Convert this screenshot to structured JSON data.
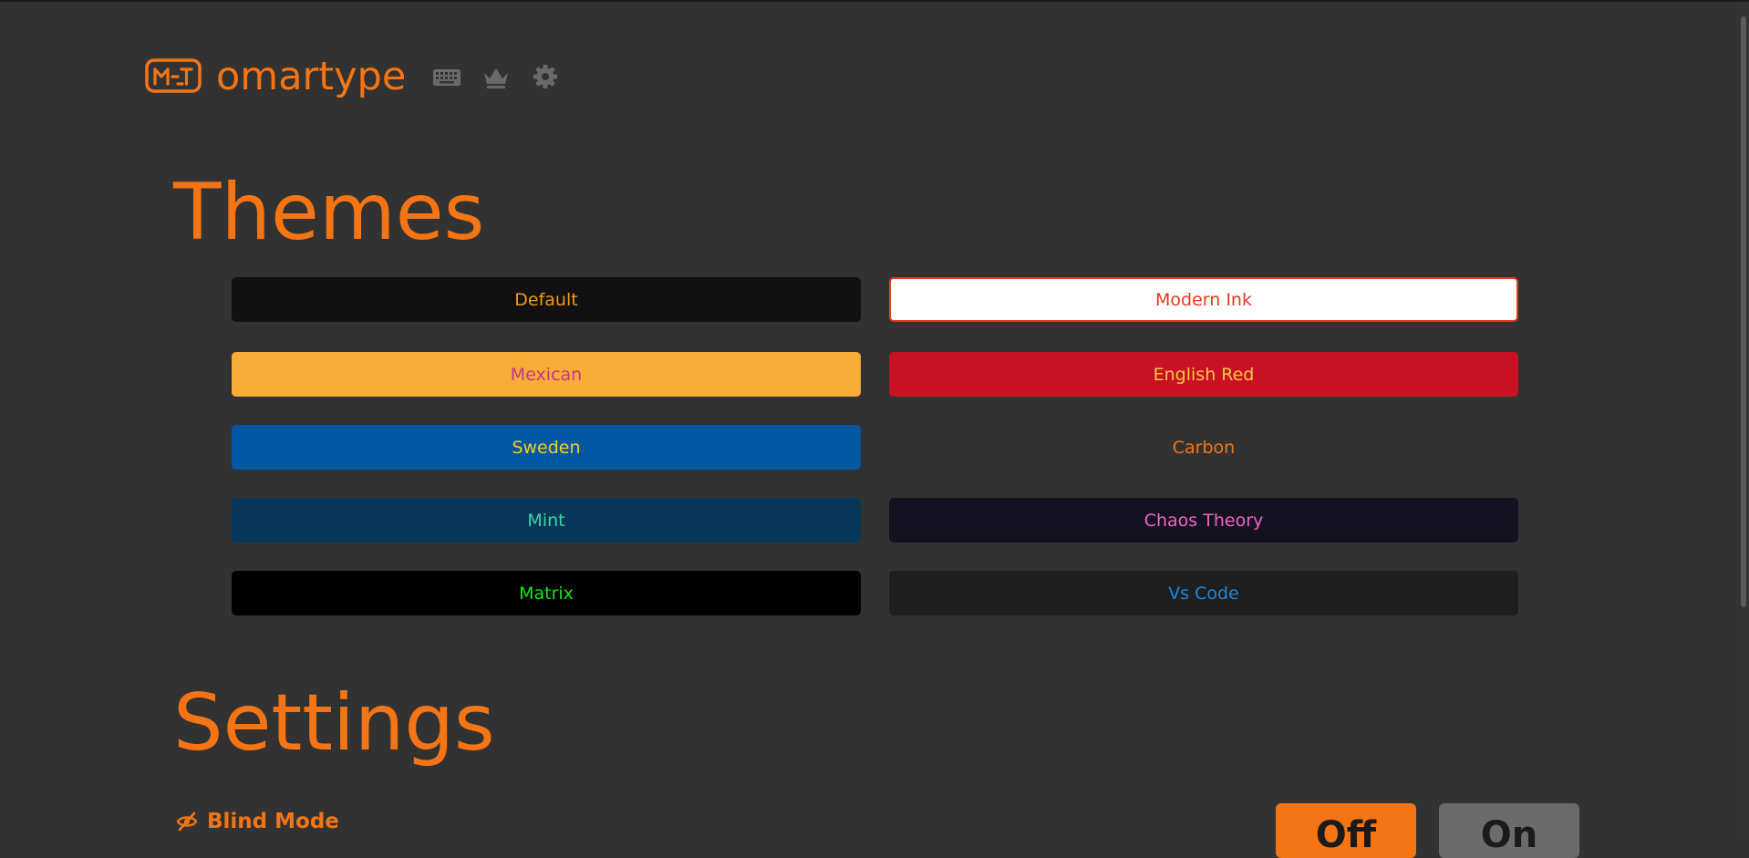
{
  "header": {
    "brand": "omartype",
    "logo_icon": "keyboard-logo-icon",
    "nav": [
      {
        "icon": "keyboard-icon"
      },
      {
        "icon": "crown-icon"
      },
      {
        "icon": "gear-icon"
      }
    ]
  },
  "themes": {
    "heading": "Themes",
    "items": [
      {
        "label": "Default",
        "bg": "#111111",
        "fg": "#f59a14"
      },
      {
        "label": "Modern Ink",
        "bg": "#ffffff",
        "fg": "#e8381f",
        "border": "#e8381f"
      },
      {
        "label": "Mexican",
        "bg": "#f7ad36",
        "fg": "#c2378a"
      },
      {
        "label": "English Red",
        "bg": "#c81224",
        "fg": "#f5c842"
      },
      {
        "label": "Sweden",
        "bg": "#0257a3",
        "fg": "#f5cf2a"
      },
      {
        "label": "Carbon",
        "bg": "#323232",
        "fg": "#f57514"
      },
      {
        "label": "Mint",
        "bg": "#06365a",
        "fg": "#3dd6a0"
      },
      {
        "label": "Chaos Theory",
        "bg": "#141221",
        "fg": "#f064c4"
      },
      {
        "label": "Matrix",
        "bg": "#000000",
        "fg": "#14e614"
      },
      {
        "label": "Vs Code",
        "bg": "#1f1f1f",
        "fg": "#1f86d8"
      }
    ]
  },
  "settings": {
    "heading": "Settings",
    "blind_mode": {
      "icon": "eye-off-icon",
      "label": "Blind Mode",
      "off_label": "Off",
      "on_label": "On"
    }
  },
  "colors": {
    "accent": "#f57514",
    "background": "#323232"
  }
}
